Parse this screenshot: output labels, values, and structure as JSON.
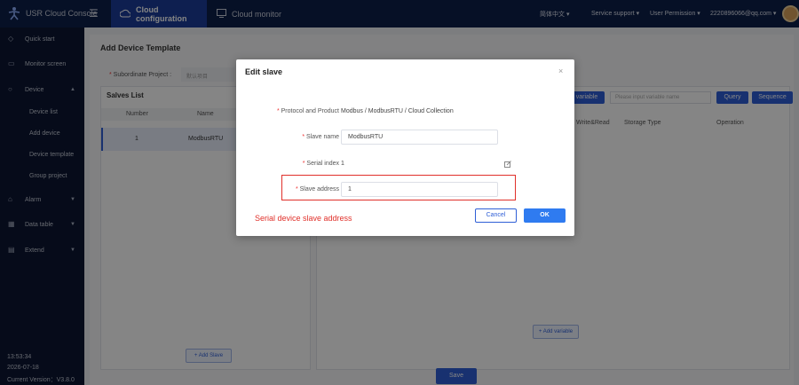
{
  "header": {
    "brand": "USR Cloud Console",
    "tabs": [
      {
        "label": "Cloud configuration",
        "icon": "cloud-icon"
      },
      {
        "label": "Cloud monitor",
        "icon": "monitor-icon"
      }
    ],
    "language": "简体中文 ▾",
    "support": "Service support ▾",
    "permission": "User Permission ▾",
    "user": "2220896066@qq.com ▾"
  },
  "sidebar": {
    "items": [
      {
        "label": "Quick start",
        "icon": "rocket-icon"
      },
      {
        "label": "Monitor screen",
        "icon": "screen-icon"
      },
      {
        "label": "Device",
        "icon": "device-icon",
        "arrow": "▲"
      },
      {
        "label": "Alarm",
        "icon": "bell-icon",
        "arrow": "▼"
      },
      {
        "label": "Data table",
        "icon": "table-icon",
        "arrow": "▼"
      },
      {
        "label": "Extend",
        "icon": "extend-icon",
        "arrow": "▼"
      }
    ],
    "sub_items": [
      "Device list",
      "Add device",
      "Device template",
      "Group project"
    ],
    "time": "13:53:34",
    "date": "2026-07-18",
    "version": "Current Version：V3.8.0"
  },
  "page": {
    "title": "Add Device Template",
    "project_label": "Subordinate Project :",
    "project_value": "默认项目",
    "slaves": {
      "title": "Salves List",
      "col_number": "Number",
      "col_name": "Name",
      "rows": [
        {
          "number": "1",
          "name": "ModbusRTU"
        }
      ],
      "add_label": "+ Add Slave"
    },
    "variables": {
      "add_variable": "variable",
      "search_placeholder": "Please input variable name",
      "query": "Query",
      "sequence": "Sequence",
      "col_rw": "Write&Read",
      "col_storage": "Storage Type",
      "col_operation": "Operation",
      "add_label": "+ Add variable"
    },
    "save": "Save"
  },
  "modal": {
    "title": "Edit slave",
    "close": "×",
    "protocol_label": "Protocol and Product",
    "protocol_value": "Modbus / ModbusRTU / Cloud Collection",
    "name_label": "Slave name",
    "name_value": "ModbusRTU",
    "index_label": "Serial index",
    "index_value": "1",
    "address_label": "Slave address",
    "address_value": "1",
    "annotation": "Serial device slave address",
    "cancel": "Cancel",
    "ok": "OK"
  },
  "colors": {
    "topbar": "#0d1f4a",
    "sidebar": "#0c1632",
    "primary": "#2f5fd6",
    "highlight": "#e0302a"
  }
}
